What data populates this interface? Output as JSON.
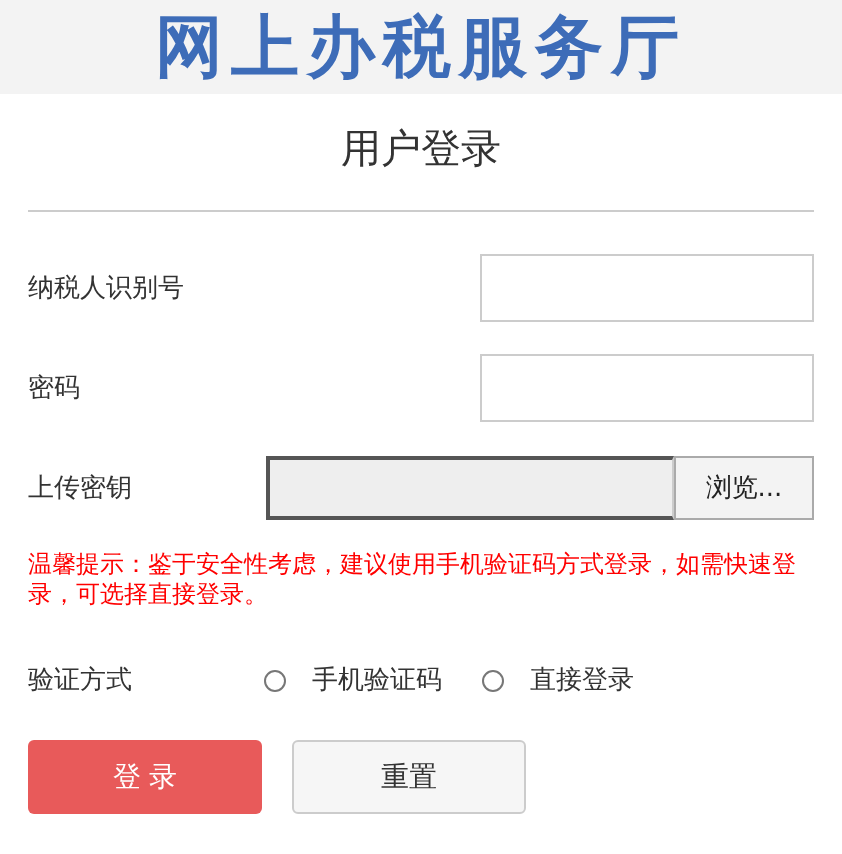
{
  "header": {
    "title": "网上办税服务厅"
  },
  "heading": "用户登录",
  "fields": [
    {
      "label": "纳税人识别号",
      "kind": "text"
    },
    {
      "label": "密码",
      "kind": "password"
    },
    {
      "label": "上传密钥",
      "kind": "file",
      "button": "浏览..."
    }
  ],
  "notice": "温馨提示：鉴于安全性考虑，建议使用手机验证码方式登录，如需快速登录，可选择直接登录。",
  "verify": {
    "label": "验证方式",
    "options": [
      {
        "label": "手机验证码",
        "selected": false
      },
      {
        "label": "直接登录",
        "selected": false
      }
    ]
  },
  "buttons": [
    {
      "label": "登 录",
      "kind": "primary"
    },
    {
      "label": "重置",
      "kind": "secondary"
    }
  ]
}
